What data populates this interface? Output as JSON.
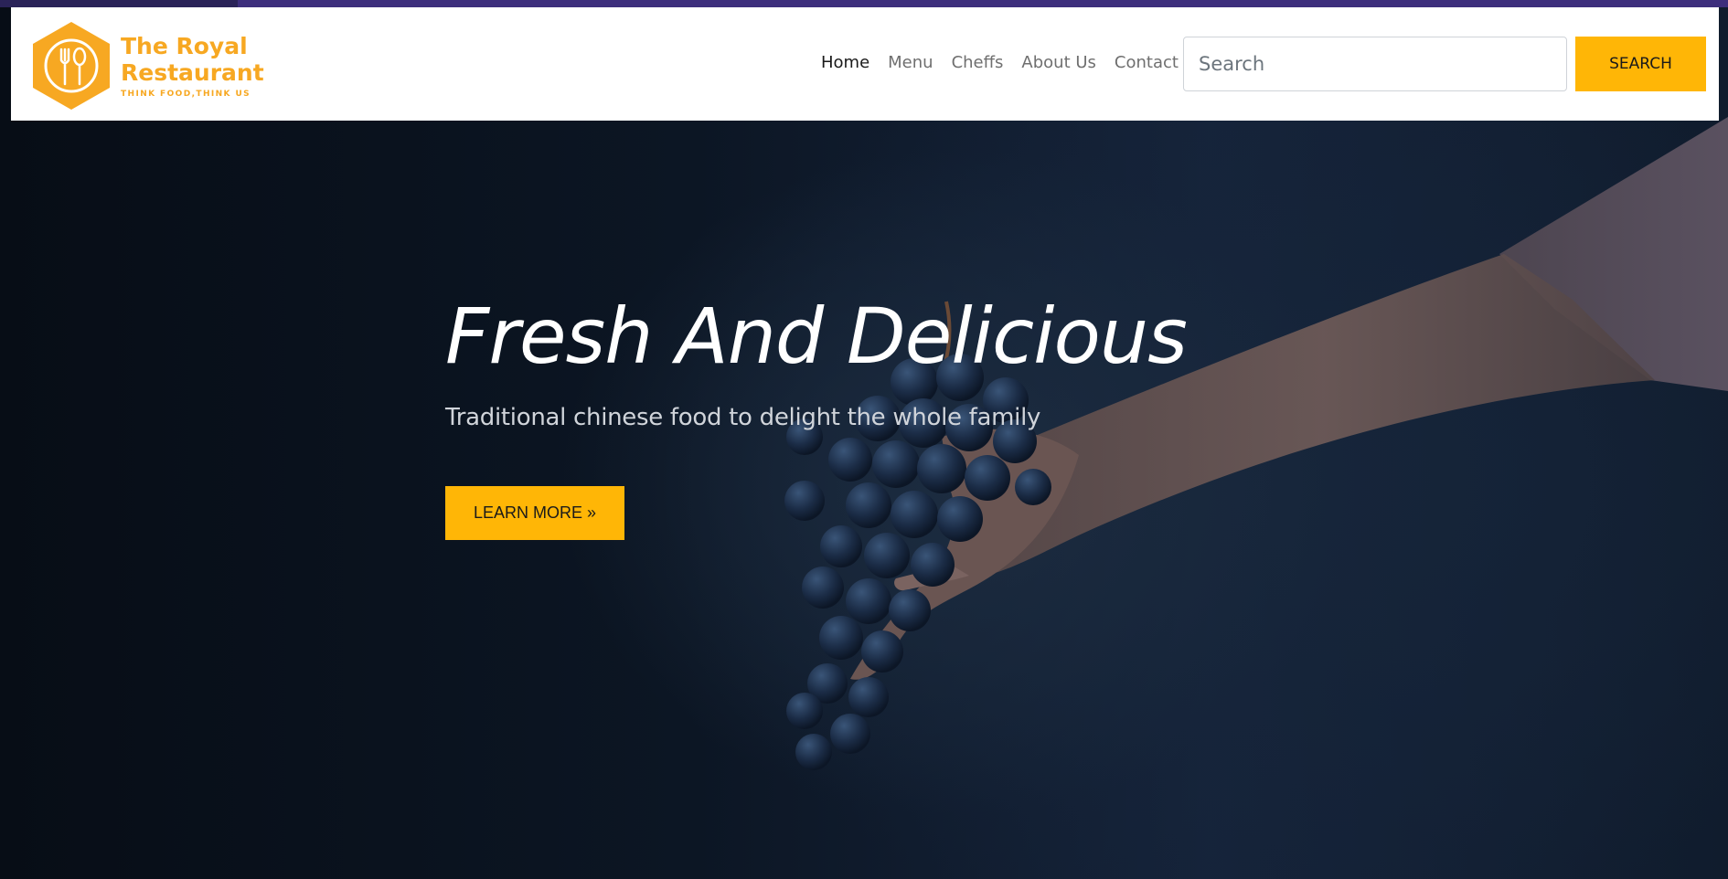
{
  "brand": {
    "name_line1": "The Royal",
    "name_line2": "Restaurant",
    "tagline": "THINK FOOD,THINK US",
    "logo_icon": "fork-spoon-hexagon-icon",
    "accent_color": "#ffb606"
  },
  "nav": {
    "items": [
      {
        "label": "Home",
        "active": true
      },
      {
        "label": "Menu",
        "active": false
      },
      {
        "label": "Cheffs",
        "active": false
      },
      {
        "label": "About Us",
        "active": false
      },
      {
        "label": "Contact",
        "active": false
      }
    ]
  },
  "search": {
    "placeholder": "Search",
    "value": "",
    "button_label": "SEARCH"
  },
  "hero": {
    "title": "Fresh And Delicious",
    "subtitle": "Traditional chinese food to delight the whole family",
    "cta_label": "LEARN MORE »",
    "background_image": "hand-holding-grapes-photo"
  },
  "colors": {
    "header_bg": "#ffffff",
    "nav_active": "#1a1a1a",
    "nav_inactive": "#6f6f6f",
    "hero_bg": "#0f1a28"
  }
}
